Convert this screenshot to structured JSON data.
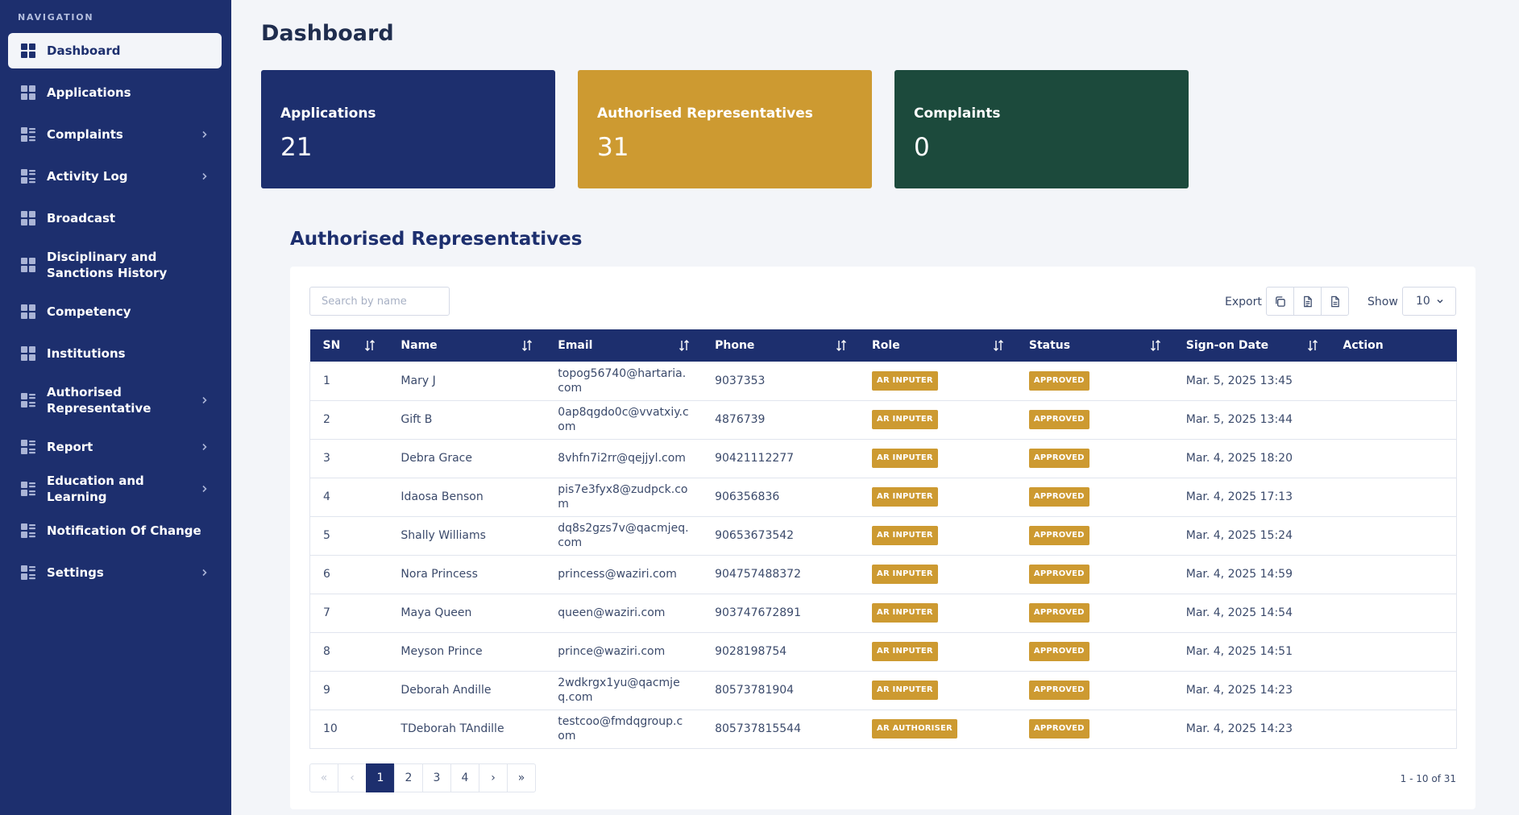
{
  "sidebar": {
    "heading": "NAVIGATION",
    "items": [
      {
        "label": "Dashboard",
        "icon": "grid-icon",
        "chevron": false,
        "active": true
      },
      {
        "label": "Applications",
        "icon": "grid-icon",
        "chevron": false
      },
      {
        "label": "Complaints",
        "icon": "list-grid-icon",
        "chevron": true
      },
      {
        "label": "Activity Log",
        "icon": "list-grid-icon",
        "chevron": true
      },
      {
        "label": "Broadcast",
        "icon": "grid-icon",
        "chevron": false
      },
      {
        "label": "Disciplinary and\nSanctions History",
        "icon": "grid-icon",
        "chevron": false,
        "tall": true
      },
      {
        "label": "Competency",
        "icon": "grid-icon",
        "chevron": false
      },
      {
        "label": "Institutions",
        "icon": "grid-icon",
        "chevron": false
      },
      {
        "label": "Authorised\nRepresentative",
        "icon": "list-grid-icon",
        "chevron": true,
        "tall": true
      },
      {
        "label": "Report",
        "icon": "list-grid-icon",
        "chevron": true
      },
      {
        "label": "Education and Learning",
        "icon": "list-grid-icon",
        "chevron": true
      },
      {
        "label": "Notification Of Change",
        "icon": "list-grid-icon",
        "chevron": false
      },
      {
        "label": "Settings",
        "icon": "list-grid-icon",
        "chevron": true
      }
    ]
  },
  "page": {
    "title": "Dashboard"
  },
  "cards": [
    {
      "label": "Applications",
      "value": "21",
      "color": "#1d2f6e"
    },
    {
      "label": "Authorised Representatives",
      "value": "31",
      "color": "#cd9a31"
    },
    {
      "label": "Complaints",
      "value": "0",
      "color": "#1c4a3c"
    }
  ],
  "section": {
    "title": "Authorised Representatives"
  },
  "toolbar": {
    "search_placeholder": "Search by name",
    "export_label": "Export",
    "export_buttons": [
      "copy-icon",
      "csv-file-icon",
      "pdf-file-icon"
    ],
    "show_label": "Show",
    "show_value": "10"
  },
  "table": {
    "columns": [
      "SN",
      "Name",
      "Email",
      "Phone",
      "Role",
      "Status",
      "Sign-on Date",
      "Action"
    ],
    "rows": [
      [
        "1",
        "Mary J",
        "topog56740@hartaria.com",
        "9037353",
        "AR INPUTER",
        "APPROVED",
        "Mar. 5, 2025 13:45"
      ],
      [
        "2",
        "Gift B",
        "0ap8qgdo0c@vvatxiy.com",
        "4876739",
        "AR INPUTER",
        "APPROVED",
        "Mar. 5, 2025 13:44"
      ],
      [
        "3",
        "Debra Grace",
        "8vhfn7i2rr@qejjyl.com",
        "90421112277",
        "AR INPUTER",
        "APPROVED",
        "Mar. 4, 2025 18:20"
      ],
      [
        "4",
        "Idaosa Benson",
        "pis7e3fyx8@zudpck.com",
        "906356836",
        "AR INPUTER",
        "APPROVED",
        "Mar. 4, 2025 17:13"
      ],
      [
        "5",
        "Shally Williams",
        "dq8s2gzs7v@qacmjeq.com",
        "90653673542",
        "AR INPUTER",
        "APPROVED",
        "Mar. 4, 2025 15:24"
      ],
      [
        "6",
        "Nora Princess",
        "princess@waziri.com",
        "904757488372",
        "AR INPUTER",
        "APPROVED",
        "Mar. 4, 2025 14:59"
      ],
      [
        "7",
        "Maya Queen",
        "queen@waziri.com",
        "903747672891",
        "AR INPUTER",
        "APPROVED",
        "Mar. 4, 2025 14:54"
      ],
      [
        "8",
        "Meyson Prince",
        "prince@waziri.com",
        "9028198754",
        "AR INPUTER",
        "APPROVED",
        "Mar. 4, 2025 14:51"
      ],
      [
        "9",
        "Deborah Andille",
        "2wdkrgx1yu@qacmjeq.com",
        "80573781904",
        "AR INPUTER",
        "APPROVED",
        "Mar. 4, 2025 14:23"
      ],
      [
        "10",
        "TDeborah TAndille",
        "testcoo@fmdqgroup.com",
        "805737815544",
        "AR AUTHORISER",
        "APPROVED",
        "Mar. 4, 2025 14:23"
      ]
    ]
  },
  "pagination": {
    "first": "«",
    "prev": "‹",
    "pages": [
      "1",
      "2",
      "3",
      "4"
    ],
    "current": "1",
    "next": "›",
    "last": "»",
    "range": "1 - 10 of 31"
  }
}
